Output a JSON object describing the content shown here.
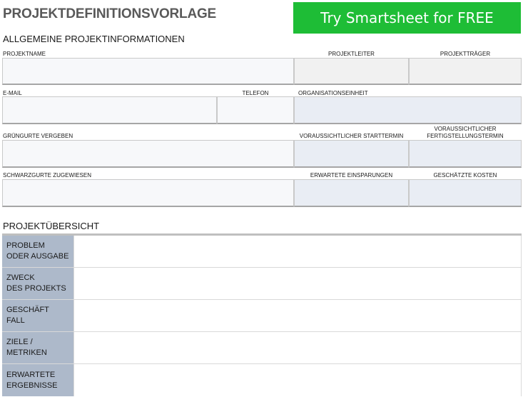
{
  "header": {
    "title": "PROJEKTDEFINITIONSVORLAGE",
    "cta_label": "Try Smartsheet for FREE"
  },
  "general": {
    "section_title": "ALLGEMEINE PROJEKTINFORMATIONEN",
    "project_name_label": "PROJEKTNAME",
    "project_manager_label": "PROJEKTLEITER",
    "project_sponsor_label": "PROJEKTTRÄGER",
    "email_label": "E-MAIL",
    "phone_label": "TELEFON",
    "org_unit_label": "ORGANISATIONSEINHEIT",
    "green_belts_label": "GRÜNGURTE VERGEBEN",
    "start_date_label": "VORAUSSICHTLICHER STARTTERMIN",
    "completion_date_label": "VORAUSSICHTLICHER FERTIGSTELLUNGSTERMIN",
    "black_belts_label": "SCHWARZGURTE ZUGEWIESEN",
    "expected_savings_label": "ERWARTETE EINSPARUNGEN",
    "estimated_costs_label": "GESCHÄTZTE KOSTEN"
  },
  "overview": {
    "section_title": "PROJEKTÜBERSICHT",
    "rows": [
      {
        "label": "PROBLEM\nODER AUSGABE"
      },
      {
        "label": "ZWECK\nDES PROJEKTS"
      },
      {
        "label": "GESCHÄFT\nFALL"
      },
      {
        "label": "ZIELE / METRIKEN"
      },
      {
        "label": "ERWARTETE\nERGEBNISSE"
      }
    ]
  }
}
